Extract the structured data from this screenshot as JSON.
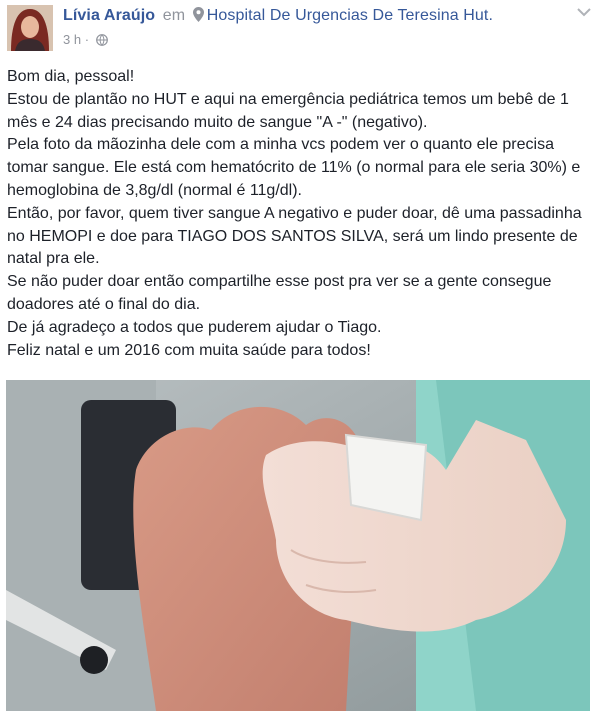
{
  "post": {
    "author": "Lívia Araújo",
    "connector": "em",
    "place_icon": "location-pin-icon",
    "place": "Hospital De Urgencias De Teresina Hut.",
    "time": "3 h",
    "separator": "·",
    "privacy_icon": "globe-icon",
    "menu_icon": "chevron-down-icon",
    "text": [
      "Bom dia, pessoal!",
      "Estou de plantão no HUT e aqui na emergência pediátrica temos um bebê de 1 mês e 24 dias precisando muito de sangue \"A -\" (negativo).",
      "Pela foto da mãozinha dele com a minha vcs podem ver o quanto ele precisa tomar sangue. Ele está com hematócrito de 11% (o normal para ele seria 30%) e hemoglobina de 3,8g/dl (normal é 11g/dl).",
      "Então, por favor, quem tiver sangue A negativo e puder doar, dê uma passadinha no HEMOPI e doe para TIAGO DOS SANTOS SILVA, será um lindo presente de natal pra ele.",
      "Se não puder doar então compartilhe esse post pra ver se a gente consegue doadores até o final do dia.",
      "De já agradeço a todos que puderem ajudar o Tiago.",
      "Feliz natal e um 2016 com muita saúde para todos!"
    ]
  },
  "colors": {
    "link": "#365899",
    "text": "#1d2129",
    "muted": "#90949c"
  }
}
